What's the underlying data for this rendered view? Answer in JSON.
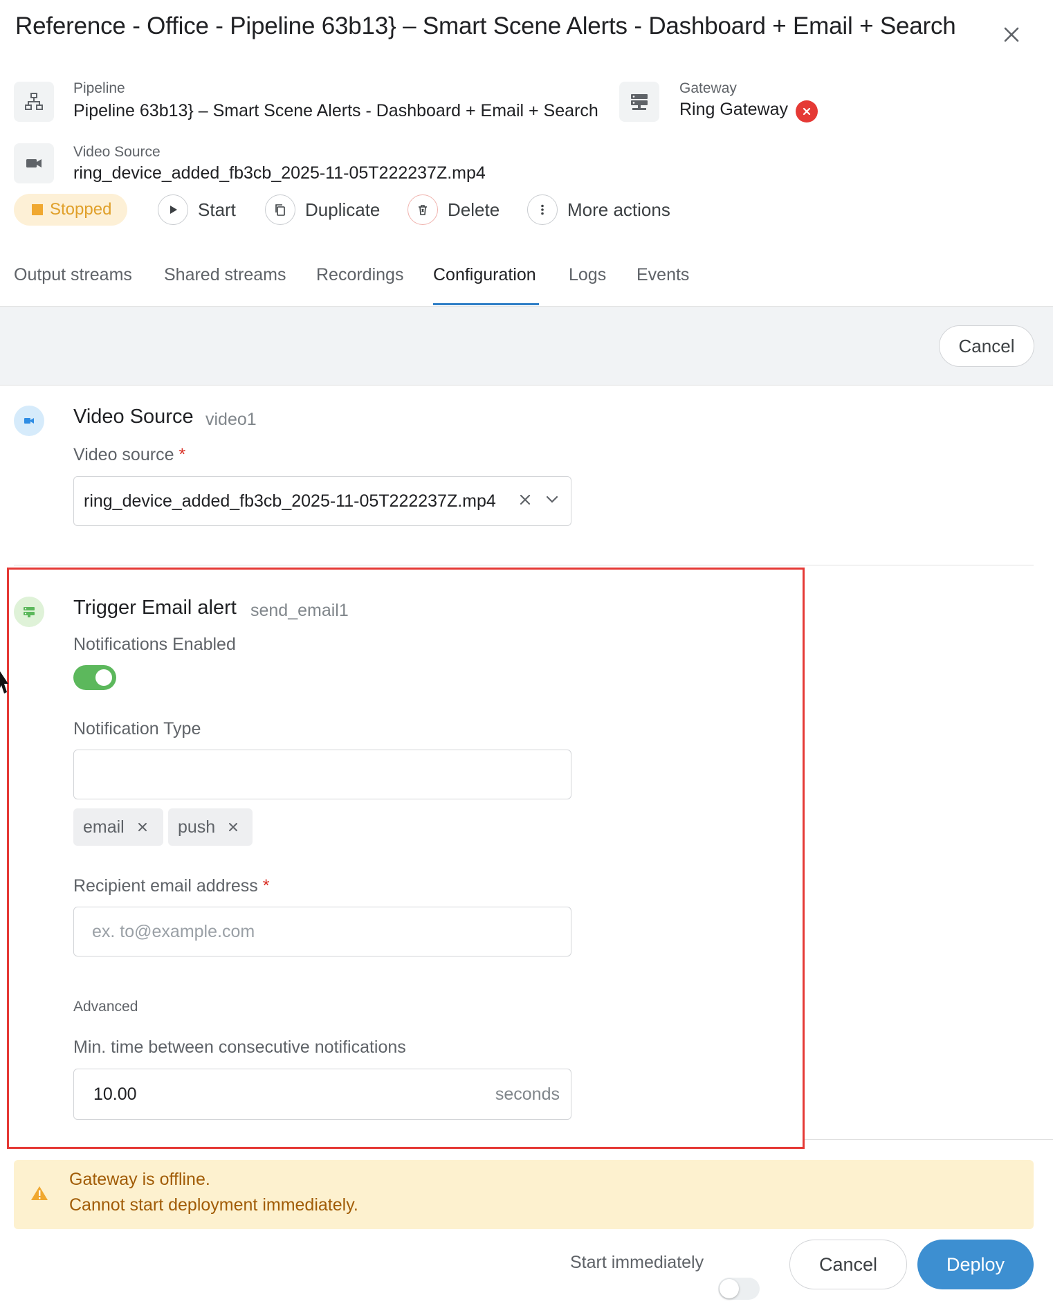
{
  "header": {
    "title": "Reference - Office - Pipeline 63b13} – Smart Scene Alerts - Dashboard + Email + Search"
  },
  "meta": {
    "pipeline_label": "Pipeline",
    "pipeline_value": "Pipeline 63b13} – Smart Scene Alerts - Dashboard + Email + Search",
    "gateway_label": "Gateway",
    "gateway_value": "Ring Gateway",
    "video_source_label": "Video Source",
    "video_source_value": "ring_device_added_fb3cb_2025-11-05T222237Z.mp4"
  },
  "status": {
    "label": "Stopped",
    "color": "#f0a830"
  },
  "actions": {
    "start": "Start",
    "duplicate": "Duplicate",
    "delete": "Delete",
    "more": "More actions"
  },
  "tabs": [
    {
      "label": "Output streams"
    },
    {
      "label": "Shared streams"
    },
    {
      "label": "Recordings"
    },
    {
      "label": "Configuration",
      "active": true
    },
    {
      "label": "Logs"
    },
    {
      "label": "Events"
    }
  ],
  "toolbar": {
    "cancel_label": "Cancel"
  },
  "video_section": {
    "title": "Video Source",
    "id": "video1",
    "field_label": "Video source",
    "required_mark": "*",
    "value": "ring_device_added_fb3cb_2025-11-05T222237Z.mp4"
  },
  "email_section": {
    "title": "Trigger Email alert",
    "id": "send_email1",
    "notifications_label": "Notifications Enabled",
    "notifications_enabled": true,
    "type_label": "Notification Type",
    "type_value": "",
    "type_tags": [
      "email",
      "push"
    ],
    "recipient_label": "Recipient email address",
    "required_mark": "*",
    "recipient_placeholder": "ex. to@example.com",
    "recipient_value": "",
    "advanced_label": "Advanced",
    "min_time_label": "Min. time between consecutive notifications",
    "min_time_value": "10.00",
    "min_time_unit": "seconds"
  },
  "alert": {
    "title": "Gateway is offline.",
    "body": "Cannot start deployment immediately."
  },
  "footer": {
    "start_immediately_label": "Start immediately",
    "start_immediately_on": false,
    "cancel_label": "Cancel",
    "deploy_label": "Deploy"
  },
  "colors": {
    "accent": "#3d8fd1",
    "tab_underline": "#2f7ec6",
    "toggle_on": "#5cb85c",
    "error": "#e53935",
    "warning_bg": "#fdf1cf",
    "warning_text": "#a15c07",
    "highlight_border": "#e53935"
  }
}
